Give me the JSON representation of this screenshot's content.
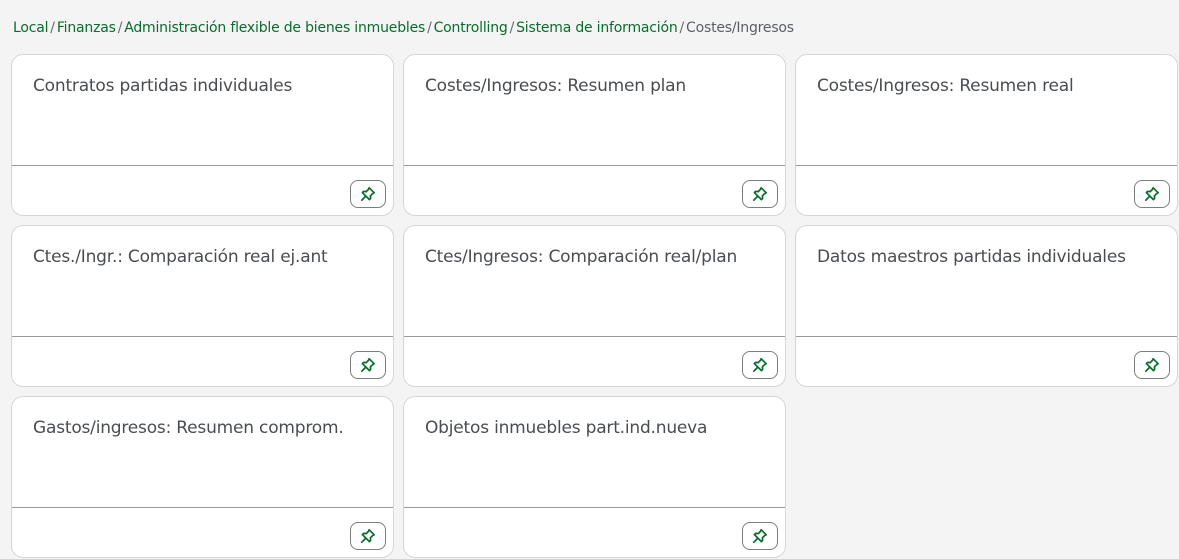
{
  "breadcrumb": {
    "links": [
      "Local",
      "Finanzas",
      "Administración flexible de bienes inmuebles",
      "Controlling",
      "Sistema de información"
    ],
    "separator": "/",
    "current": "Costes/Ingresos"
  },
  "tiles": [
    {
      "title": "Contratos partidas individuales"
    },
    {
      "title": "Costes/Ingresos: Resumen plan"
    },
    {
      "title": "Costes/Ingresos: Resumen real"
    },
    {
      "title": "Ctes./Ingr.: Comparación real ej.ant"
    },
    {
      "title": "Ctes/Ingresos: Comparación real/plan"
    },
    {
      "title": "Datos maestros partidas individuales"
    },
    {
      "title": "Gastos/ingresos: Resumen comprom."
    },
    {
      "title": "Objetos inmuebles part.ind.nueva"
    }
  ],
  "colors": {
    "accent": "#0b6b2e",
    "pin_icon": "#0b6b2e",
    "background": "#f4f4f4"
  },
  "icons": {
    "pin": "pin-icon"
  }
}
